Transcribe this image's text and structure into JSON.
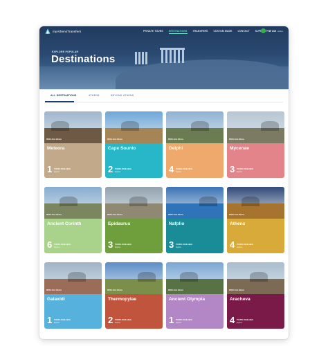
{
  "nav": {
    "logo": "myAthensTransfers",
    "items": [
      "PRIVATE TOURS",
      "DESTINATIONS",
      "TRANSFERS",
      "CUSTOM MADE",
      "CONTACT",
      "SUPPORT"
    ],
    "active_index": 1,
    "phone": "+30 210",
    "phone_label": "online"
  },
  "hero": {
    "subtitle": "EXPLORE POPULAR",
    "title": "Destinations"
  },
  "tabs": [
    "ALL DESTINATIONS",
    "ATHENS",
    "BEYOND ATHENS"
  ],
  "destinations": [
    {
      "name": "Meteora",
      "count": "1",
      "tours_label": "TOURS AVAILABLE",
      "explore": "Explore",
      "caption": "Within from Athens",
      "color": "#c1a98a",
      "sky": "#9fb6cc",
      "ground": "#6e5a44"
    },
    {
      "name": "Cape Sounio",
      "count": "2",
      "tours_label": "TOURS AVAILABLE",
      "explore": "Explore",
      "caption": "Within from Athens",
      "color": "#28b7c8",
      "sky": "#6ea7d8",
      "ground": "#a58456"
    },
    {
      "name": "Delphi",
      "count": "4",
      "tours_label": "TOURS AVAILABLE",
      "explore": "Explore",
      "caption": "Within from Athens",
      "color": "#f0a96c",
      "sky": "#8fb2d3",
      "ground": "#6b7b52"
    },
    {
      "name": "Mycenae",
      "count": "3",
      "tours_label": "TOURS AVAILABLE",
      "explore": "Explore",
      "caption": "Within from Athens",
      "color": "#e2848a",
      "sky": "#b7c6d2",
      "ground": "#7b7a63"
    },
    {
      "name": "Ancient Corinth",
      "count": "6",
      "tours_label": "TOURS AVAILABLE",
      "explore": "Explore",
      "caption": "Within from Athens",
      "color": "#a9d28a",
      "sky": "#88acd0",
      "ground": "#7b8660"
    },
    {
      "name": "Epidaurus",
      "count": "3",
      "tours_label": "TOURS AVAILABLE",
      "explore": "Explore",
      "caption": "Within from Athens",
      "color": "#6f9e3c",
      "sky": "#93a2ad",
      "ground": "#8f8873"
    },
    {
      "name": "Nafplio",
      "count": "3",
      "tours_label": "TOURS AVAILABLE",
      "explore": "Explore",
      "caption": "Within from Athens",
      "color": "#198c98",
      "sky": "#3b73b5",
      "ground": "#2f73b8"
    },
    {
      "name": "Athens",
      "count": "4",
      "tours_label": "TOURS AVAILABLE",
      "explore": "Explore",
      "caption": "Within from Athens",
      "color": "#d8aa3a",
      "sky": "#324a78",
      "ground": "#a7742f"
    },
    {
      "name": "Galaxidi",
      "count": "1",
      "tours_label": "TOURS AVAILABLE",
      "explore": "Explore",
      "caption": "Within from Athens",
      "color": "#56b2dc",
      "sky": "#9fb3c6",
      "ground": "#9b6d58"
    },
    {
      "name": "Thermopylae",
      "count": "2",
      "tours_label": "TOURS AVAILABLE",
      "explore": "Explore",
      "caption": "Within from Athens",
      "color": "#c0543d",
      "sky": "#5b8dc7",
      "ground": "#7b8f4a"
    },
    {
      "name": "Ancient Olympia",
      "count": "1",
      "tours_label": "TOURS AVAILABLE",
      "explore": "Explore",
      "caption": "Within from Athens",
      "color": "#b387c6",
      "sky": "#7aa6d4",
      "ground": "#597245"
    },
    {
      "name": "Aracheva",
      "count": "4",
      "tours_label": "TOURS AVAILABLE",
      "explore": "Explore",
      "caption": "Within from Athens",
      "color": "#7a1a48",
      "sky": "#a9bccd",
      "ground": "#7c6a55"
    }
  ]
}
